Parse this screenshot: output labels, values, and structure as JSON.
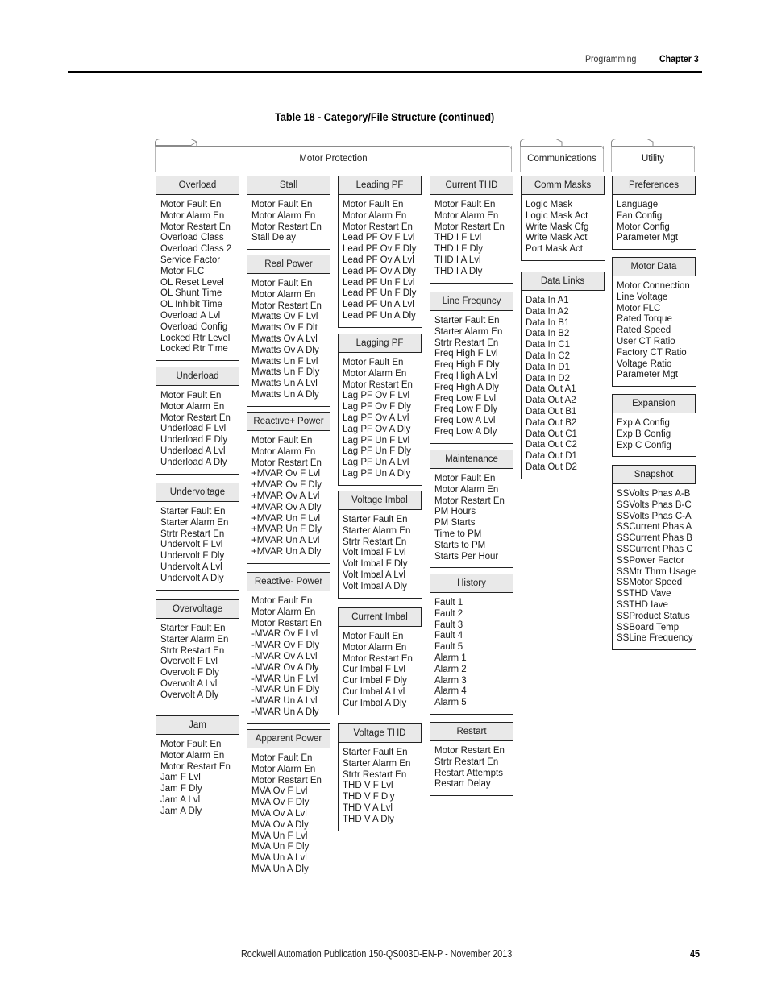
{
  "header": {
    "section": "Programming",
    "chapter": "Chapter 3"
  },
  "table_title": "Table 18 - Category/File Structure (continued)",
  "categories": {
    "motor_protection": "Motor Protection",
    "communications": "Communications",
    "utility": "Utility"
  },
  "groups": {
    "overload": {
      "title": "Overload",
      "items": [
        "Motor Fault En",
        "Motor Alarm En",
        "Motor Restart En",
        "Overload Class",
        "Overload Class 2",
        "Service Factor",
        "Motor FLC",
        "OL Reset Level",
        "OL Shunt Time",
        "OL Inhibit Time",
        "Overload A Lvl",
        "Overload Config",
        "Locked Rtr Level",
        "Locked Rtr Time"
      ]
    },
    "underload": {
      "title": "Underload",
      "items": [
        "Motor Fault En",
        "Motor Alarm En",
        "Motor Restart En",
        "Underload F Lvl",
        "Underload F Dly",
        "Underload A Lvl",
        "Underload A Dly"
      ]
    },
    "undervoltage": {
      "title": "Undervoltage",
      "items": [
        "Starter Fault En",
        "Starter Alarm En",
        "Strtr Restart En",
        "Undervolt F Lvl",
        "Undervolt F Dly",
        "Undervolt A Lvl",
        "Undervolt A Dly"
      ]
    },
    "overvoltage": {
      "title": "Overvoltage",
      "items": [
        "Starter Fault En",
        "Starter Alarm En",
        "Strtr Restart En",
        "Overvolt F Lvl",
        "Overvolt F Dly",
        "Overvolt A Lvl",
        "Overvolt A Dly"
      ]
    },
    "jam": {
      "title": "Jam",
      "items": [
        "Motor Fault En",
        "Motor Alarm En",
        "Motor Restart En",
        "Jam F Lvl",
        "Jam F Dly",
        "Jam A Lvl",
        "Jam A Dly"
      ]
    },
    "stall": {
      "title": "Stall",
      "items": [
        "Motor Fault En",
        "Motor Alarm En",
        "Motor Restart En",
        "Stall Delay"
      ]
    },
    "real_power": {
      "title": "Real Power",
      "items": [
        "Motor Fault En",
        "Motor Alarm En",
        "Motor Restart En",
        "Mwatts Ov F Lvl",
        "Mwatts Ov F Dlt",
        "Mwatts Ov A Lvl",
        "Mwatts Ov A Dly",
        "Mwatts Un F Lvl",
        "Mwatts Un F Dly",
        "Mwatts Un A Lvl",
        "Mwatts Un A Dly"
      ]
    },
    "reactive_plus_power": {
      "title": "Reactive+ Power",
      "items": [
        "Motor Fault En",
        "Motor Alarm En",
        "Motor Restart En",
        "+MVAR Ov F Lvl",
        "+MVAR Ov F Dly",
        "+MVAR Ov A Lvl",
        "+MVAR Ov A Dly",
        "+MVAR Un F Lvl",
        "+MVAR Un F Dly",
        "+MVAR Un A Lvl",
        "+MVAR Un A Dly"
      ]
    },
    "reactive_minus_power": {
      "title": "Reactive- Power",
      "items": [
        "Motor Fault En",
        "Motor Alarm En",
        "Motor Restart En",
        "-MVAR Ov F Lvl",
        "-MVAR Ov F Dly",
        "-MVAR Ov A Lvl",
        "-MVAR Ov A Dly",
        "-MVAR Un F Lvl",
        "-MVAR Un F Dly",
        "-MVAR Un A Lvl",
        "-MVAR Un A Dly"
      ]
    },
    "apparent_power": {
      "title": "Apparent Power",
      "items": [
        "Motor Fault En",
        "Motor Alarm En",
        "Motor Restart En",
        "MVA Ov F Lvl",
        "MVA Ov F Dly",
        "MVA Ov A Lvl",
        "MVA Ov A Dly",
        "MVA Un F Lvl",
        "MVA Un F Dly",
        "MVA Un A Lvl",
        "MVA Un A Dly"
      ]
    },
    "leading_pf": {
      "title": "Leading PF",
      "items": [
        "Motor Fault En",
        "Motor Alarm En",
        "Motor Restart En",
        "Lead PF Ov F Lvl",
        "Lead PF Ov F Dly",
        "Lead PF Ov A Lvl",
        "Lead PF Ov A Dly",
        "Lead PF Un F Lvl",
        "Lead PF Un F Dly",
        "Lead PF Un A Lvl",
        "Lead PF Un A Dly"
      ]
    },
    "lagging_pf": {
      "title": "Lagging PF",
      "items": [
        "Motor Fault En",
        "Motor Alarm En",
        "Motor Restart En",
        "Lag PF Ov F Lvl",
        "Lag PF Ov F Dly",
        "Lag PF Ov A Lvl",
        "Lag PF Ov A Dly",
        "Lag PF Un F Lvl",
        "Lag PF Un F Dly",
        "Lag PF Un A Lvl",
        "Lag PF Un A Dly"
      ]
    },
    "voltage_imbal": {
      "title": "Voltage Imbal",
      "items": [
        "Starter Fault En",
        "Starter Alarm En",
        "Strtr Restart En",
        "Volt Imbal F Lvl",
        "Volt Imbal F Dly",
        "Volt Imbal A Lvl",
        "Volt Imbal A Dly"
      ]
    },
    "current_imbal": {
      "title": "Current Imbal",
      "items": [
        "Motor Fault En",
        "Motor Alarm En",
        "Motor Restart En",
        "Cur Imbal F Lvl",
        "Cur Imbal F Dly",
        "Cur Imbal A Lvl",
        "Cur Imbal A Dly"
      ]
    },
    "voltage_thd": {
      "title": "Voltage THD",
      "items": [
        "Starter Fault En",
        "Starter Alarm En",
        "Strtr Restart En",
        "THD V F Lvl",
        "THD V F Dly",
        "THD V A Lvl",
        "THD V A Dly"
      ]
    },
    "current_thd": {
      "title": "Current THD",
      "items": [
        "Motor Fault En",
        "Motor Alarm En",
        "Motor Restart En",
        "THD I F Lvl",
        "THD I F Dly",
        "THD I A Lvl",
        "THD I A Dly"
      ]
    },
    "line_frequency": {
      "title": "Line Frequncy",
      "items": [
        "Starter Fault En",
        "Starter Alarm En",
        "Strtr Restart En",
        "Freq High F Lvl",
        "Freq High F Dly",
        "Freq High A Lvl",
        "Freq High A Dly",
        "Freq Low F Lvl",
        "Freq Low F Dly",
        "Freq Low A Lvl",
        "Freq Low A Dly"
      ]
    },
    "maintenance": {
      "title": "Maintenance",
      "items": [
        "Motor Fault En",
        "Motor Alarm En",
        "Motor Restart En",
        "PM Hours",
        "PM Starts",
        "Time to PM",
        "Starts to PM",
        "Starts Per Hour"
      ]
    },
    "history": {
      "title": "History",
      "items": [
        "Fault 1",
        "Fault 2",
        "Fault 3",
        "Fault 4",
        "Fault 5",
        "Alarm 1",
        "Alarm 2",
        "Alarm 3",
        "Alarm 4",
        "Alarm 5"
      ]
    },
    "restart": {
      "title": "Restart",
      "items": [
        "Motor Restart En",
        "Strtr Restart En",
        "Restart Attempts",
        "Restart Delay"
      ]
    },
    "comm_masks": {
      "title": "Comm Masks",
      "items": [
        "Logic Mask",
        "Logic Mask Act",
        "Write Mask Cfg",
        "Write Mask Act",
        "Port Mask Act"
      ]
    },
    "data_links": {
      "title": "Data Links",
      "items": [
        "Data In A1",
        "Data In A2",
        "Data In B1",
        "Data In B2",
        "Data In C1",
        "Data In C2",
        "Data In D1",
        "Data In D2",
        "Data Out A1",
        "Data Out A2",
        "Data Out B1",
        "Data Out B2",
        "Data Out C1",
        "Data Out C2",
        "Data Out D1",
        "Data Out D2"
      ]
    },
    "preferences": {
      "title": "Preferences",
      "items": [
        "Language",
        "Fan Config",
        "Motor Config",
        "Parameter Mgt"
      ]
    },
    "motor_data": {
      "title": "Motor Data",
      "items": [
        "Motor Connection",
        "Line Voltage",
        "Motor FLC",
        "Rated Torque",
        "Rated Speed",
        "User CT Ratio",
        "Factory CT Ratio",
        "Voltage Ratio",
        "Parameter Mgt"
      ]
    },
    "expansion": {
      "title": "Expansion",
      "items": [
        "Exp A Config",
        "Exp B Config",
        "Exp C Config"
      ]
    },
    "snapshot": {
      "title": "Snapshot",
      "items": [
        "SSVolts Phas A-B",
        "SSVolts Phas B-C",
        "SSVolts Phas C-A",
        "SSCurrent Phas A",
        "SSCurrent Phas B",
        "SSCurrent Phas C",
        "SSPower Factor",
        "SSMtr Thrm Usage",
        "SSMotor Speed",
        "SSTHD Vave",
        "SSTHD Iave",
        "SSProduct Status",
        "SSBoard Temp",
        "SSLine Frequency"
      ]
    }
  },
  "footer": {
    "publication": "Rockwell Automation Publication  150-QS003D-EN-P - November 2013",
    "page_number": "45"
  }
}
